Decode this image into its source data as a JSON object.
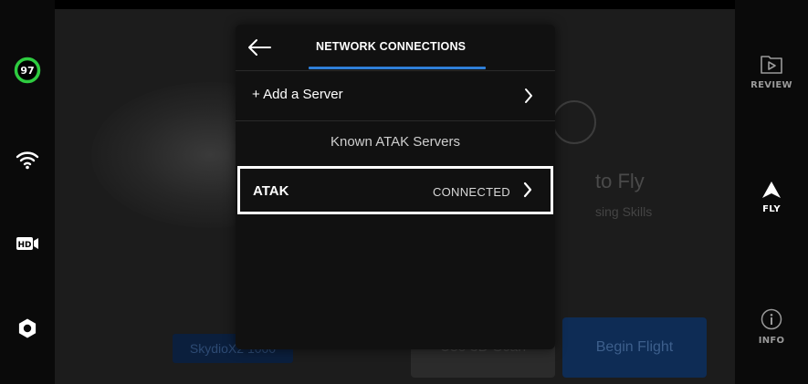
{
  "left_rail": {
    "battery_percent": "97",
    "battery_level": 97,
    "battery_color": "#2ecc40",
    "icons": [
      "wifi-icon",
      "hd-camera-icon",
      "gear-icon"
    ]
  },
  "background": {
    "title_fragment": "to Fly",
    "subtitle_fragment": "sing Skills",
    "skydio_button": "SkydioX2 1000",
    "scan_button": "Use 3D Scan",
    "begin_button": "Begin Flight"
  },
  "right_nav": {
    "review": "REVIEW",
    "fly": "FLY",
    "info": "INFO"
  },
  "modal": {
    "title": "NETWORK CONNECTIONS",
    "add_server": "+ Add a Server",
    "section_label": "Known ATAK Servers",
    "servers": [
      {
        "name": "ATAK",
        "status": "CONNECTED"
      }
    ]
  },
  "colors": {
    "accent": "#2f7fd8",
    "battery": "#2ecc40"
  }
}
